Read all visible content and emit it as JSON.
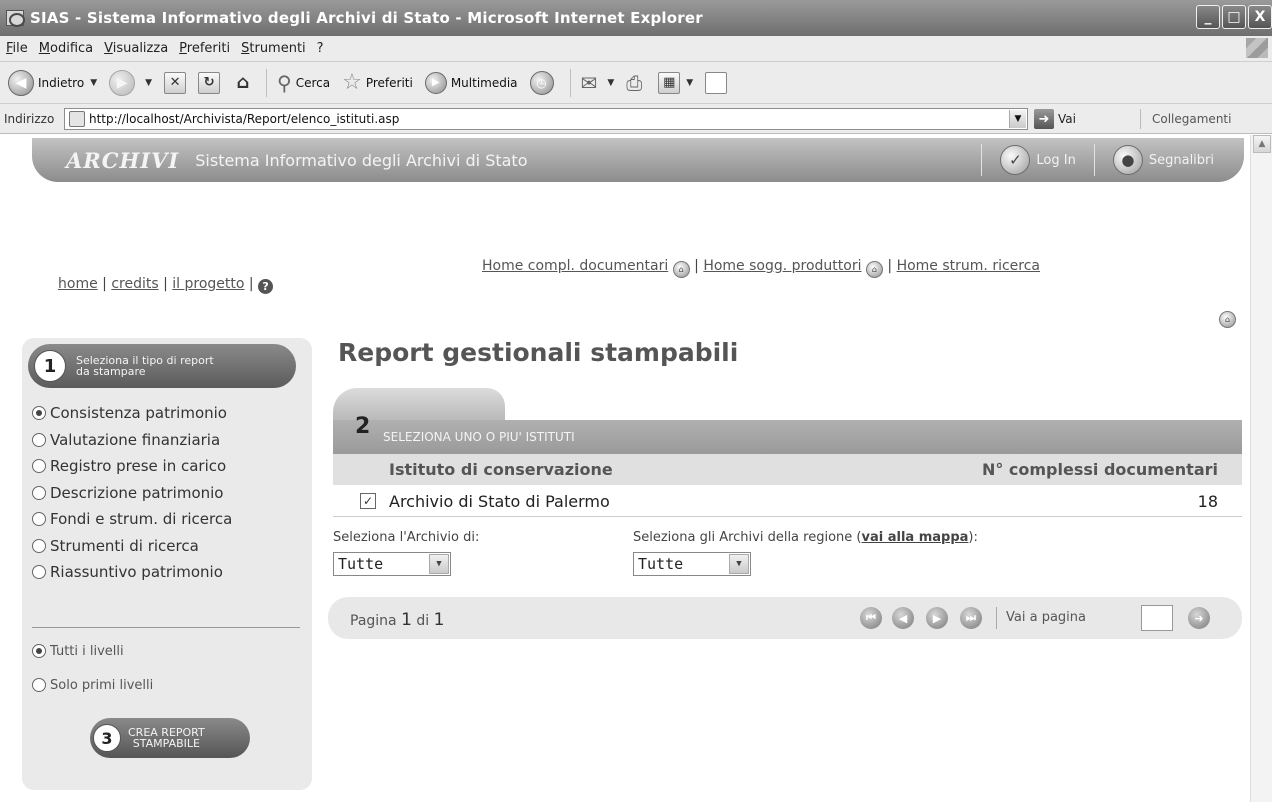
{
  "window": {
    "title": "SIAS - Sistema Informativo degli Archivi di Stato - Microsoft Internet Explorer",
    "buttons": [
      "_",
      "□",
      "X"
    ]
  },
  "menubar": {
    "items": [
      "File",
      "Modifica",
      "Visualizza",
      "Preferiti",
      "Strumenti",
      "?"
    ]
  },
  "toolbar": {
    "back_label": "Indietro",
    "search_label": "Cerca",
    "favorites_label": "Preferiti",
    "media_label": "Multimedia"
  },
  "addressbar": {
    "label": "Indirizzo",
    "url": "http://localhost/Archivista/Report/elenco_istituti.asp",
    "go_label": "Vai",
    "links_label": "Collegamenti"
  },
  "site_header": {
    "logo": "ARCHIVI",
    "subtitle": "Sistema Informativo degli Archivi di Stato",
    "login_label": "Log In",
    "bookmarks_label": "Segnalibri"
  },
  "top_links": {
    "home": "home",
    "credits": "credits",
    "project": "il progetto",
    "sep": "|"
  },
  "home_links": {
    "compl": "Home compl. documentari",
    "sogg": "Home sogg. produttori",
    "strum": "Home strum. ricerca",
    "sep": "|"
  },
  "left_panel": {
    "step1_number": "1",
    "step1_label": "Seleziona il tipo di report da stampare",
    "report_types": [
      {
        "label": "Consistenza patrimonio",
        "selected": true
      },
      {
        "label": "Valutazione finanziaria",
        "selected": false
      },
      {
        "label": "Registro prese in carico",
        "selected": false
      },
      {
        "label": "Descrizione patrimonio",
        "selected": false
      },
      {
        "label": "Fondi e strum. di ricerca",
        "selected": false
      },
      {
        "label": "Strumenti di ricerca",
        "selected": false
      },
      {
        "label": "Riassuntivo patrimonio",
        "selected": false
      }
    ],
    "levels": [
      {
        "label": "Tutti i livelli",
        "selected": true
      },
      {
        "label": "Solo primi livelli",
        "selected": false
      }
    ],
    "step3_number": "3",
    "step3_line1": "CREA REPORT",
    "step3_line2": "STAMPABILE"
  },
  "main": {
    "title": "Report gestionali stampabili",
    "step2_number": "2",
    "step2_label": "SELEZIONA UNO O PIU' ISTITUTI",
    "col_institute": "Istituto di conservazione",
    "col_count": "N° complessi documentari",
    "rows": [
      {
        "checked": true,
        "name": "Archivio di Stato di Palermo",
        "count": "18"
      }
    ],
    "filter_archive_label": "Seleziona l'Archivio di:",
    "filter_archive_value": "Tutte",
    "filter_region_label": "Seleziona gli Archivi della regione (",
    "filter_region_link": "vai alla mappa",
    "filter_region_label_end": "):",
    "filter_region_value": "Tutte"
  },
  "pager": {
    "page_word": "Pagina",
    "current": "1",
    "of_word": "di",
    "total": "1",
    "goto_label": "Vai a pagina"
  },
  "colors": {
    "header_gray": "#8c8c8c",
    "panel_bg": "#eaeaea",
    "step_bar": "#a3a3a3"
  }
}
